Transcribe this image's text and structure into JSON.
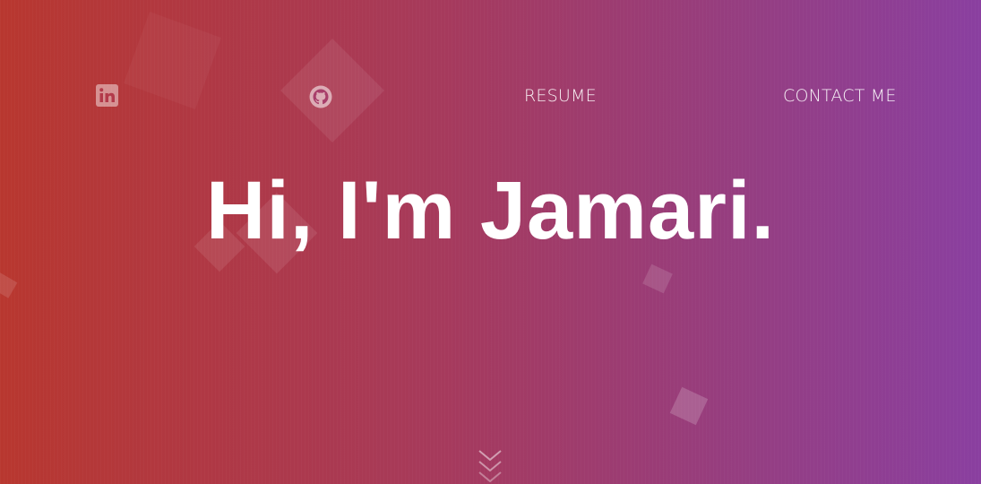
{
  "nav": {
    "linkedin_icon": "linkedin-icon",
    "github_icon": "github-icon",
    "resume_label": "RESUME",
    "contact_label": "CONTACT ME"
  },
  "hero": {
    "title": "Hi, I'm Jamari."
  },
  "scroll": {
    "icon": "double-chevron-down-icon"
  },
  "colors": {
    "gradient_start": "#b8372f",
    "gradient_mid": "#a63a5c",
    "gradient_end": "#8a3fa0",
    "text": "#ffffff"
  }
}
